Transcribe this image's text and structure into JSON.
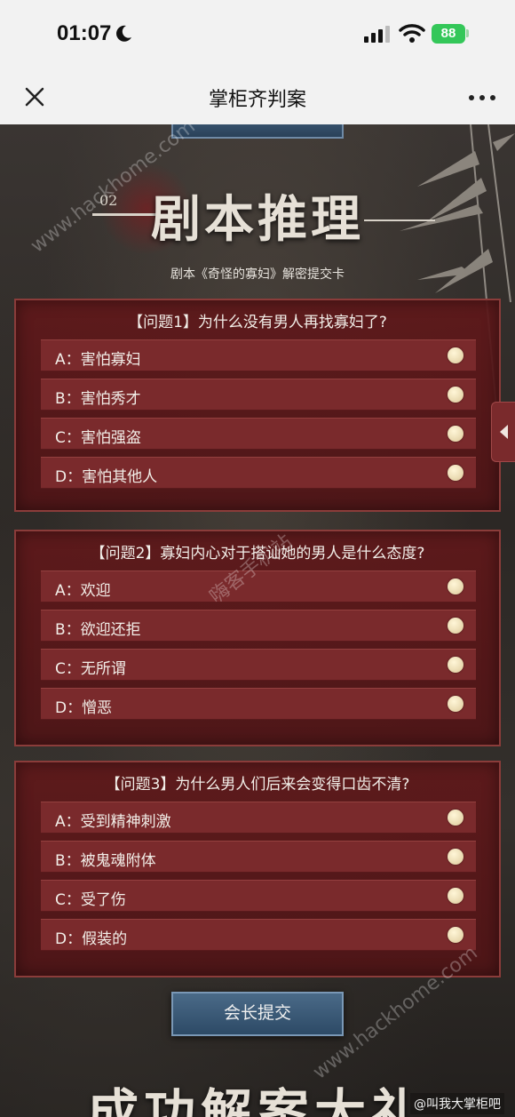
{
  "status": {
    "time": "01:07",
    "battery": "88"
  },
  "titlebar": {
    "title": "掌柜齐判案"
  },
  "page": {
    "section_number": "02",
    "heading": "剧本推理",
    "subtitle": "剧本《奇怪的寡妇》解密提交卡",
    "questions": [
      {
        "title": "【问题1】为什么没有男人再找寡妇了?",
        "options": [
          "A：害怕寡妇",
          "B：害怕秀才",
          "C：害怕强盗",
          "D：害怕其他人"
        ]
      },
      {
        "title": "【问题2】寡妇内心对于搭讪她的男人是什么态度?",
        "options": [
          "A：欢迎",
          "B：欲迎还拒",
          "C：无所谓",
          "D：憎恶"
        ]
      },
      {
        "title": "【问题3】为什么男人们后来会变得口齿不清?",
        "options": [
          "A：受到精神刺激",
          "B：被鬼魂附体",
          "C：受了伤",
          "D：假装的"
        ]
      }
    ],
    "submit_label": "会长提交",
    "bottom_heading": "成功解案大礼",
    "credit": "@叫我大掌柜吧",
    "watermarks": [
      "www.hackhome.com",
      "嗨客手机站",
      "www.hackhome.com"
    ]
  },
  "colors": {
    "card": "#601a1c",
    "option": "#7a2a2c",
    "submit": "#2d4a66"
  },
  "icons": [
    "moon-icon",
    "signal-icon",
    "wifi-icon",
    "close-icon",
    "more-icon",
    "chevron-left-icon"
  ]
}
